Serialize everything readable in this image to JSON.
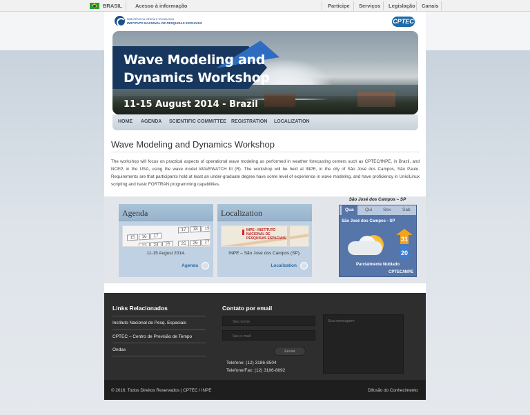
{
  "gov_bar": {
    "country": "BRASIL",
    "access": "Acesso à informação",
    "links": [
      "Participe",
      "Serviços",
      "Legislação",
      "Canais"
    ]
  },
  "header": {
    "inpe_line1": "MINISTÉRIO DA CIÊNCIA E TECNOLOGIA",
    "inpe_line2": "INSTITUTO NACIONAL DE PESQUISAS ESPACIAIS",
    "cptec_logo": "CPTEC"
  },
  "banner": {
    "title_line1": "Wave Modeling and",
    "title_line2": "Dynamics Workshop",
    "dates": "11-15 August 2014 - Brazil"
  },
  "nav": [
    "HOME",
    "AGENDA",
    "SCIENTIFIC COMMITTEE",
    "REGISTRATION",
    "LOCALIZATION"
  ],
  "main": {
    "title": "Wave Modeling and Dynamics Workshop",
    "description": "The workshop will focus on practical aspects of operational wave modeling as performed in weather forecasting centers such as CPTEC/INPE, in Brazil, and NCEP, in the USA, using the wave model WAVEWATCH III (R). The workshop will be held at INPE, in the city of São José dos Campos, São Paulo. Requirements are that participants hold at least an under-graduate degree have some level of experience in wave modeling, and have proficiency in Unix/Linux scripting and basic FORTRAN programming capabilities."
  },
  "cards": {
    "agenda": {
      "title": "Agenda",
      "text": "11-15 August 2014.",
      "link": "Agenda",
      "calendar_days": [
        "17",
        "18",
        "19",
        "15",
        "16",
        "17",
        "25",
        "26",
        "27",
        "23",
        "24",
        "25"
      ]
    },
    "localization": {
      "title": "Localization",
      "map_label": "INPE - INSTITUTO NACIONAL DE PESQUISAS ESPACIAIS",
      "text": "INPE – São José dos Campos (SP).",
      "link": "Localization"
    }
  },
  "weather": {
    "title": "São José dos Campos – SP",
    "tabs": [
      "Qua",
      "Qui",
      "Sex",
      "Sab"
    ],
    "city": "São José dos Campos - SP",
    "max": "31",
    "min": "20",
    "condition": "Parcialmente Nublado",
    "source": "CPTEC/INPE",
    "colors": {
      "panel": "#5675a9",
      "max_arrow": "#f5a31d",
      "min_arrow": "#3f7ed0"
    }
  },
  "footer": {
    "links_title": "Links Relacionados",
    "links": [
      "Instituto Nacional de Pesq. Espaciais",
      "CPTEC – Centro de Previsão de Tempo",
      "Ondas"
    ],
    "contact_title": "Contato por email",
    "name_placeholder": "Seu nome",
    "email_placeholder": "Seu e-mail",
    "message_placeholder": "Sua mensagem",
    "send_label": "Enviar",
    "phone": "Telefone: (12) 3186-8504",
    "fax": "Telefone/Fax: (12) 3186-8692",
    "copyright": "© 2016. Todos Direitos Reservados | CPTEC / INPE",
    "right_link": "Difusão do Conhecimento"
  }
}
